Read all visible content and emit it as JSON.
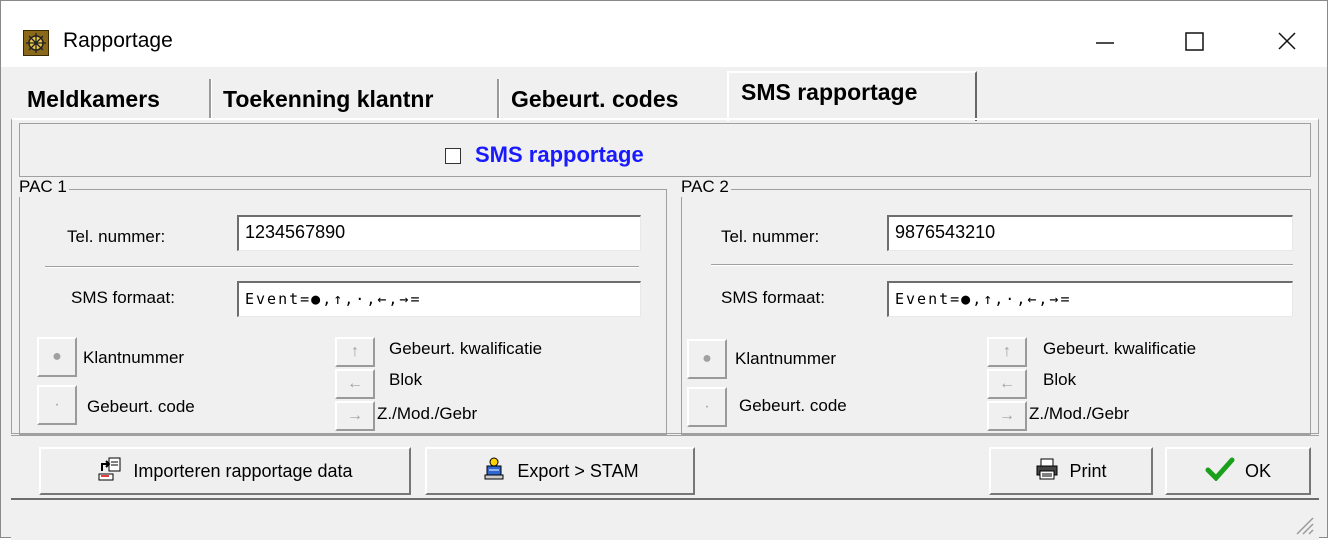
{
  "window": {
    "title": "Rapportage"
  },
  "tabs": [
    {
      "label": "Meldkamers"
    },
    {
      "label": "Toekenning klantnr"
    },
    {
      "label": "Gebeurt. codes"
    },
    {
      "label": "SMS rapportage",
      "active": true
    }
  ],
  "sms_rapportage": {
    "label": "SMS rapportage",
    "checked": false,
    "label_color": "#1a1aff"
  },
  "pac1": {
    "legend": "PAC 1",
    "tel_label": "Tel. nummer:",
    "tel_value": "1234567890",
    "sms_label": "SMS formaat:",
    "sms_value": "Event=●,↑,·,←,→=",
    "klantnummer": "Klantnummer",
    "gebeurt_code": "Gebeurt. code",
    "kwalificatie": "Gebeurt. kwalificatie",
    "blok": "Blok",
    "zmod": "Z./Mod./Gebr"
  },
  "pac2": {
    "legend": "PAC 2",
    "tel_label": "Tel. nummer:",
    "tel_value": "9876543210",
    "sms_label": "SMS formaat:",
    "sms_value": "Event=●,↑,·,←,→=",
    "klantnummer": "Klantnummer",
    "gebeurt_code": "Gebeurt. code",
    "kwalificatie": "Gebeurt. kwalificatie",
    "blok": "Blok",
    "zmod": "Z./Mod./Gebr"
  },
  "buttons": {
    "import": "Importeren rapportage data",
    "export": "Export > STAM",
    "print": "Print",
    "ok": "OK"
  },
  "icons": {
    "minimize": "minimize-icon",
    "maximize": "maximize-icon",
    "close": "close-icon"
  }
}
